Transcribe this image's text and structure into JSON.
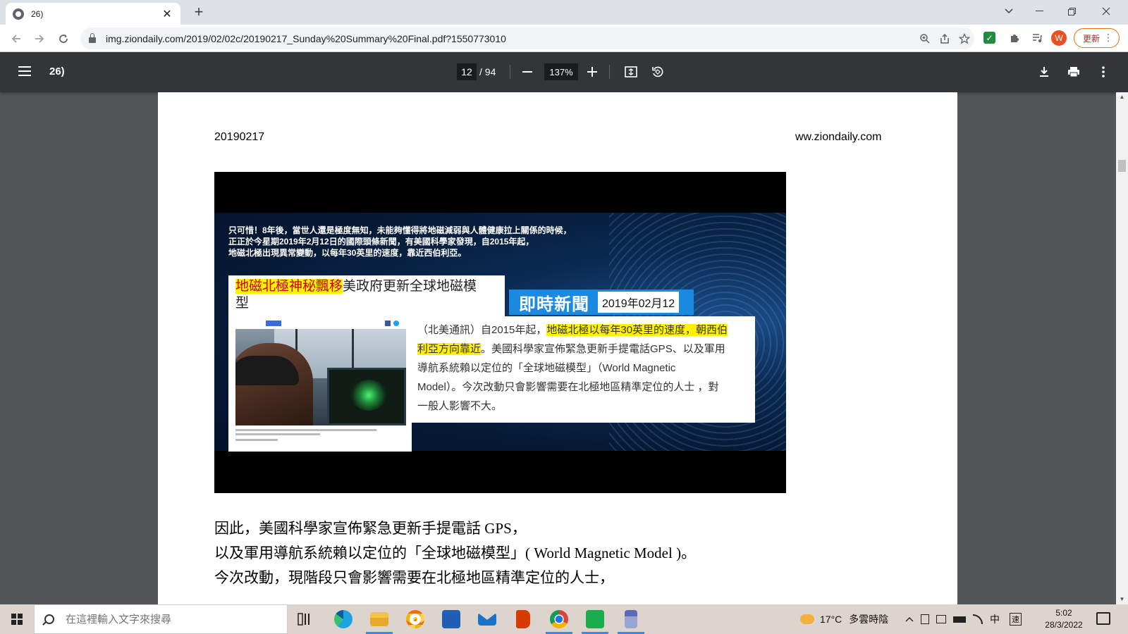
{
  "browser": {
    "tab_title": "26)",
    "tab_close": "✕",
    "new_tab": "+",
    "url": "img.ziondaily.com/2019/02/02c/20190217_Sunday%20Summary%20Final.pdf?1550773010",
    "avatar_letter": "W",
    "update_label": "更新",
    "icons": [
      "back-icon",
      "forward-icon",
      "reload-icon",
      "lock-icon",
      "zoom-icon",
      "share-icon",
      "star-icon",
      "extension-check-icon",
      "puzzle-icon",
      "media-icon",
      "menu-dots-icon"
    ]
  },
  "pdf": {
    "title": "26)",
    "page_current": "12",
    "page_total": "/ 94",
    "zoom": "137%",
    "zoom_out": "—",
    "zoom_in": "+"
  },
  "page": {
    "header_date": "20190217",
    "header_site": "ww.ziondaily.com",
    "figure": {
      "intro_lines": [
        "只可惜！8年後，當世人還是極度無知，未能夠懂得將地磁減弱與人體健康拉上關係的時候，",
        "正正於今星期2019年2月12日的國際頭條新聞，有美國科學家發現，自2015年起，",
        "地磁北極出現異常變動，以每年30英里的速度，靠近西伯利亞。"
      ],
      "headline_highlight": "地磁北極神秘飄移",
      "headline_rest": "美政府更新全球地磁模",
      "headline_rest2": "型",
      "live_label": "即時新聞",
      "live_date": "2019年02月12",
      "article_prefix": "（北美通訊）自2015年起，",
      "article_highlight_1": "地磁北極以每年30英里的速度，朝西伯",
      "article_highlight_2": "利亞方向靠近",
      "article_rest_1": "。美國科學家宣佈緊急更新手提電話GPS、以及軍用",
      "article_rest_2": "導航系統賴以定位的「全球地磁模型」（World Magnetic",
      "article_rest_3": "Model）。今次改動只會影響需要在北極地區精準定位的人士 ，對",
      "article_rest_4": "一般人影響不大。"
    },
    "body_lines": [
      "因此，美國科學家宣佈緊急更新手提電話 GPS，",
      "以及軍用導航系統賴以定位的「全球地磁模型」( World Magnetic Model )。",
      "今次改動，現階段只會影響需要在北極地區精準定位的人士，"
    ]
  },
  "taskbar": {
    "search_placeholder": "在這裡輸入文字來搜尋",
    "weather_temp": "17°C",
    "weather_desc": "多雲時陰",
    "ime_lang": "中",
    "ime_mode": "速",
    "clock_time": "5:02",
    "clock_date": "28/3/2022"
  }
}
